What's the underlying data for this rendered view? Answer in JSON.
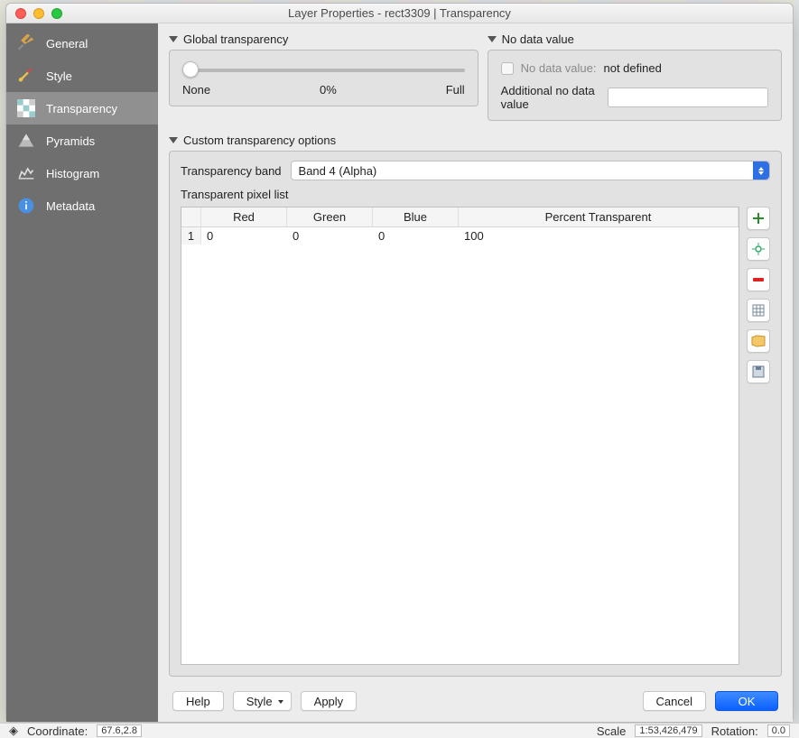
{
  "title": "Layer Properties - rect3309 | Transparency",
  "sidebar": {
    "items": [
      {
        "label": "General"
      },
      {
        "label": "Style"
      },
      {
        "label": "Transparency"
      },
      {
        "label": "Pyramids"
      },
      {
        "label": "Histogram"
      },
      {
        "label": "Metadata"
      }
    ]
  },
  "global_transparency": {
    "heading": "Global transparency",
    "none": "None",
    "percent": "0%",
    "full": "Full"
  },
  "no_data": {
    "heading": "No data value",
    "checkbox_label": "No data value:",
    "value": "not defined",
    "additional_label": "Additional no data value",
    "additional_value": ""
  },
  "custom": {
    "heading": "Custom transparency options",
    "band_label": "Transparency band",
    "band_value": "Band 4 (Alpha)",
    "list_label": "Transparent pixel list",
    "columns": {
      "red": "Red",
      "green": "Green",
      "blue": "Blue",
      "pct": "Percent Transparent"
    },
    "rows": [
      {
        "idx": "1",
        "red": "0",
        "green": "0",
        "blue": "0",
        "pct": "100"
      }
    ]
  },
  "buttons": {
    "help": "Help",
    "style": "Style",
    "apply": "Apply",
    "cancel": "Cancel",
    "ok": "OK"
  },
  "statusbar": {
    "coord_label": "Coordinate:",
    "coord_value": "67.6,2.8",
    "scale_label": "Scale",
    "scale_value": "1:53,426,479",
    "rot_label": "Rotation:",
    "rot_value": "0.0"
  }
}
